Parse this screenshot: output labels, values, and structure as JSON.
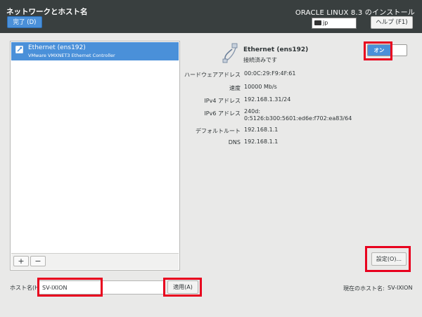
{
  "header": {
    "title": "ネットワークとホスト名",
    "done_label": "完了 (D)",
    "product": "ORACLE LINUX 8.3 のインストール",
    "keyboard_layout": "jp",
    "help_label": "ヘルプ (F1)"
  },
  "list": {
    "items": [
      {
        "name": "Ethernet (ens192)",
        "description": "VMware VMXNET3 Ethernet Controller"
      }
    ],
    "add_label": "+",
    "remove_label": "−"
  },
  "detail": {
    "name": "Ethernet (ens192)",
    "status": "接続済みです",
    "toggle_label": "オン",
    "fields": [
      {
        "label": "ハードウェアアドレス",
        "value": "00:0C:29:F9:4F:61"
      },
      {
        "label": "速度",
        "value": "10000 Mb/s"
      },
      {
        "label": "IPv4 アドレス",
        "value": "192.168.1.31/24"
      },
      {
        "label": "IPv6 アドレス",
        "value": "240d:",
        "value2": "0:5126:b300:5601:ed6e:f702:ea83/64"
      },
      {
        "label": "デフォルトルート",
        "value": "192.168.1.1"
      },
      {
        "label": "DNS",
        "value": "192.168.1.1"
      }
    ],
    "settings_label": "設定(O)..."
  },
  "hostname": {
    "label": "ホスト名(H):",
    "value": "SV-IXION",
    "apply_label": "適用(A)",
    "current_label": "現在のホスト名:",
    "current_value": "SV-IXION"
  },
  "colors": {
    "header_bg": "#393f3f",
    "accent": "#4a90d9",
    "highlight": "#e8001e"
  }
}
